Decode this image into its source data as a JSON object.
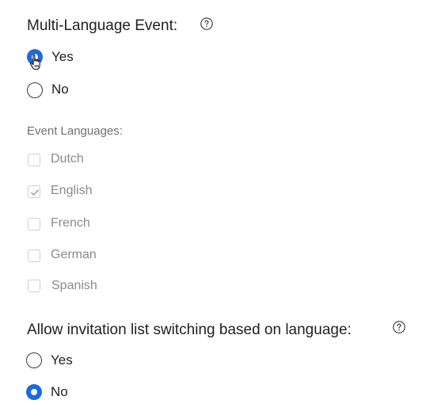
{
  "multi_language": {
    "title": "Multi-Language Event:",
    "help_icon": "question-circle-icon",
    "options": [
      {
        "label": "Yes",
        "selected": true
      },
      {
        "label": "No",
        "selected": false
      }
    ]
  },
  "event_languages": {
    "label": "Event Languages:",
    "items": [
      {
        "label": "Dutch",
        "checked": false
      },
      {
        "label": "English",
        "checked": true
      },
      {
        "label": "French",
        "checked": false
      },
      {
        "label": "German",
        "checked": false
      },
      {
        "label": "Spanish",
        "checked": false
      }
    ]
  },
  "invitation_switching": {
    "title": "Allow invitation list switching based on language:",
    "help_icon": "question-circle-icon",
    "options": [
      {
        "label": "Yes",
        "selected": false
      },
      {
        "label": "No",
        "selected": true
      }
    ]
  },
  "colors": {
    "accent": "#1a6ae0",
    "disabled_text": "#8a8a8a",
    "label_gray": "#707070"
  },
  "cursor_icon": "hand-pointer-icon"
}
